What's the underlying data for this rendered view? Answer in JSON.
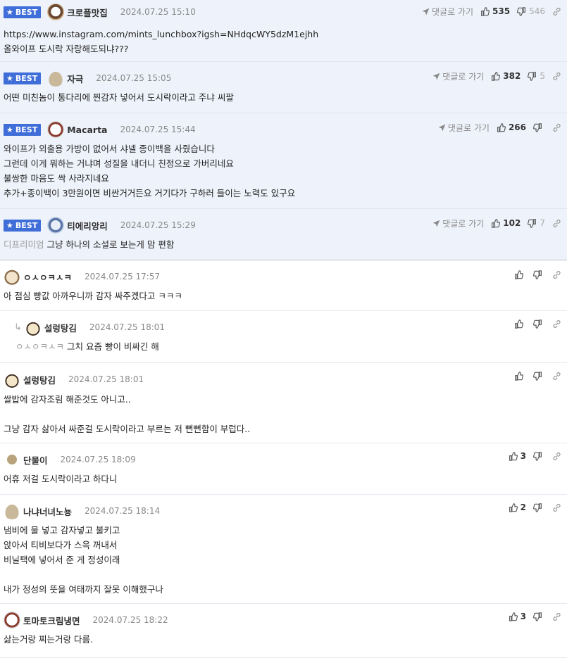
{
  "comments": [
    {
      "best": true,
      "badge": "BEST",
      "avatar": "dog",
      "nick": "크로플맛집",
      "date": "2024.07.25 15:10",
      "reply_label": "댓글로 가기",
      "up": "535",
      "down": "546",
      "lines": [
        "https://www.instagram.com/mints_lunchbox?igsh=NHdqcWY5dzM1ejhh",
        "올와이프 도시락 자랑해도되냐???"
      ]
    },
    {
      "best": true,
      "badge": "BEST",
      "avatar": "pan",
      "nick": "자극",
      "date": "2024.07.25 15:05",
      "reply_label": "댓글로 가기",
      "up": "382",
      "down": "5",
      "lines": [
        "어떤 미친놈이 통다리에 찐감자 넣어서 도시락이라고 주냐 씨팔"
      ]
    },
    {
      "best": true,
      "badge": "BEST",
      "avatar": "white",
      "nick": "Macarta",
      "date": "2024.07.25 15:44",
      "reply_label": "댓글로 가기",
      "up": "266",
      "down": "",
      "lines": [
        "와이프가 외출용 가방이 없어서 샤넬 종이백을 사줬습니다",
        "그런데 이게 뭐하는 거냐며 성질을 내더니 친정으로 가버리네요",
        "불쌍한 마음도 싹 사라지네요",
        "추가+종이백이 3만원이면 비싼거거든요 거기다가 구하러 들이는 노력도 있구요"
      ]
    },
    {
      "best": true,
      "badge": "BEST",
      "avatar": "blue",
      "nick": "티에리앙리",
      "date": "2024.07.25 15:29",
      "reply_label": "댓글로 가기",
      "up": "102",
      "down": "7",
      "ref": "디프리미엄",
      "lines": [
        "그냥 하나의 소설로 보는게 맘 편함"
      ]
    },
    {
      "best": false,
      "avatar": "puppy",
      "nick": "ㅇㅅㅇㅋㅅㅋ",
      "date": "2024.07.25 17:57",
      "up": "",
      "down": "",
      "lines": [
        "아 점심 빵값 아까우니까 감자 싸주겠다고 ㅋㅋㅋ"
      ]
    },
    {
      "best": false,
      "indent": true,
      "avatar": "fennec",
      "nick": "설렁탕김",
      "date": "2024.07.25 18:01",
      "up": "",
      "down": "",
      "ref": "ㅇㅅㅇㅋㅅㅋ",
      "lines": [
        "그치 요즘 빵이 비싸긴 해"
      ]
    },
    {
      "best": false,
      "avatar": "fennec",
      "nick": "설렁탕김",
      "date": "2024.07.25 18:01",
      "up": "",
      "down": "",
      "lines": [
        "쌀밥에 감자조림 해준것도 아니고..",
        "",
        "그냥 감자 삶아서 싸준걸 도시락이라고 부르는 저 뻔뻔함이 부럽다.."
      ]
    },
    {
      "best": false,
      "avatar": "dot",
      "nick": "단물이",
      "date": "2024.07.25 18:09",
      "up": "3",
      "down": "",
      "lines": [
        "어휴 저걸 도시락이라고 하다니"
      ]
    },
    {
      "best": false,
      "avatar": "pan",
      "nick": "나냐너녀노뇽",
      "date": "2024.07.25 18:14",
      "up": "2",
      "down": "",
      "lines": [
        "냄비에 물 넣고 감자넣고 불키고",
        "앉아서 티비보다가 스윽 꺼내서",
        "비닐팩에 넣어서 준 게 정성이래",
        "",
        "내가 정성의 뜻을 여태까지 잘못 이해했구나"
      ]
    },
    {
      "best": false,
      "avatar": "white",
      "nick": "토마토크림냉면",
      "date": "2024.07.25 18:22",
      "up": "3",
      "down": "",
      "lines": [
        "삶는거랑 찌는거랑 다름."
      ]
    }
  ]
}
